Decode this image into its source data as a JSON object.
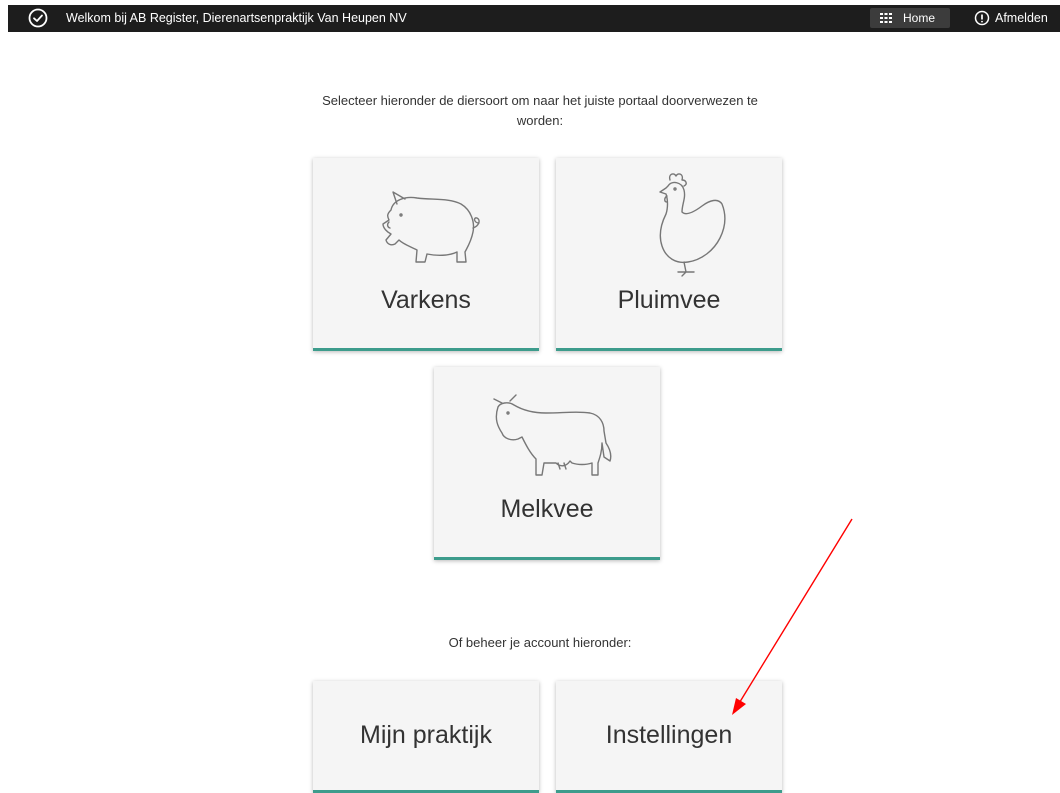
{
  "topbar": {
    "welcome": "Welkom bij AB Register, Dierenartsenpraktijk Van Heupen NV",
    "home_label": "Home",
    "logout_label": "Afmelden",
    "icons": {
      "status": "check-circle-icon",
      "home": "grid-icon",
      "logout": "info-circle-icon"
    }
  },
  "main": {
    "intro_text": "Selecteer hieronder de diersoort om naar het juiste portaal doorverwezen te worden:",
    "animal_tiles": [
      {
        "label": "Varkens",
        "icon": "pig-icon"
      },
      {
        "label": "Pluimvee",
        "icon": "chicken-icon"
      },
      {
        "label": "Melkvee",
        "icon": "cow-icon"
      }
    ],
    "manage_text": "Of beheer je account hieronder:",
    "account_tiles": [
      {
        "label": "Mijn praktijk"
      },
      {
        "label": "Instellingen"
      }
    ]
  },
  "colors": {
    "topbar": "#1d1d1d",
    "accent": "#3d9c8c",
    "tile_bg": "#f5f5f5",
    "annotation_arrow": "#ff0000"
  }
}
